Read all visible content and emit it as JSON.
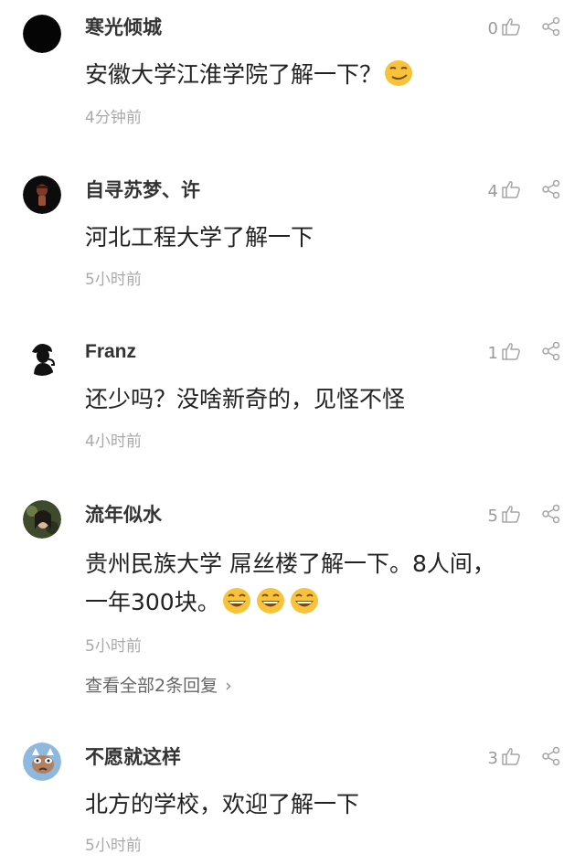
{
  "comments": [
    {
      "username": "寒光倾城",
      "likes": "0",
      "text": "安徽大学江淮学院了解一下？",
      "emoji": "smirk-face",
      "time": "4分钟前"
    },
    {
      "username": "自寻苏梦、许",
      "likes": "4",
      "text": "河北工程大学了解一下",
      "time": "5小时前"
    },
    {
      "username": "Franz",
      "likes": "1",
      "text": "还少吗？没啥新奇的，见怪不怪",
      "time": "4小时前"
    },
    {
      "username": "流年似水",
      "likes": "5",
      "text_line1": "贵州民族大学 屌丝楼了解一下。8人间，",
      "text_line2": "一年300块。",
      "emoji": "grinning-face x3",
      "time": "5小时前",
      "view_replies": "查看全部2条回复",
      "view_replies_chevron": "›"
    },
    {
      "username": "不愿就这样",
      "likes": "3",
      "text": "北方的学校，欢迎了解一下",
      "time": "5小时前"
    }
  ],
  "icons": {
    "like": "thumb-up-outline-icon",
    "share": "share-icon"
  },
  "colors": {
    "muted": "#9a9a9a",
    "text": "#222222",
    "username": "#333333",
    "emoji_yellow": "#f7c33a"
  }
}
